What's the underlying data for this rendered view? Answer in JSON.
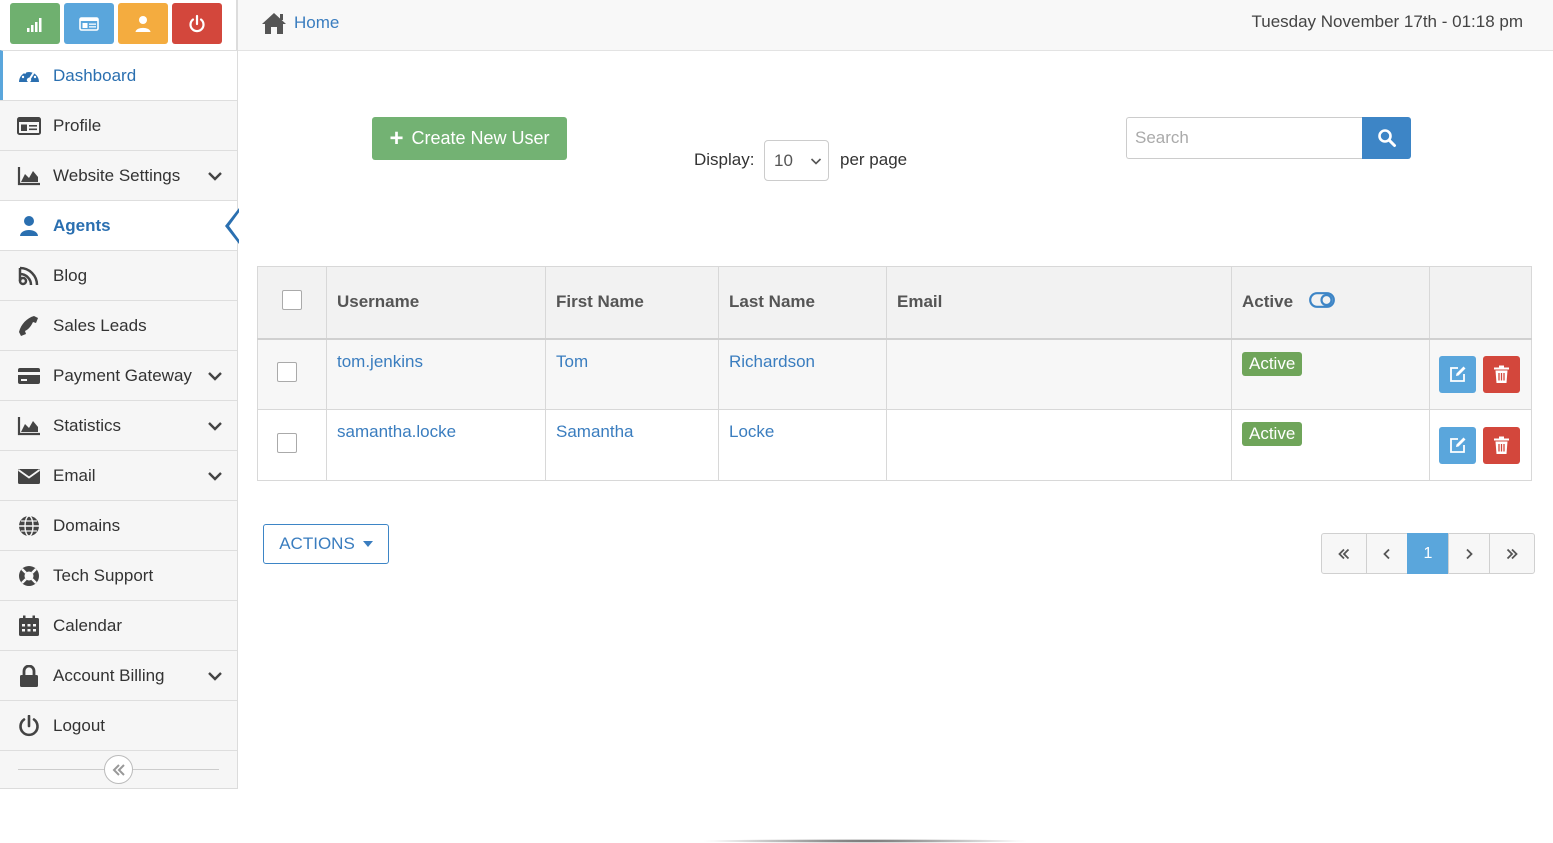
{
  "colors": {
    "shortcut_green": "#6fb06f",
    "shortcut_blue": "#5aa6dc",
    "shortcut_orange": "#f4ac3f",
    "shortcut_red": "#d3473c",
    "link_blue": "#3a7dbf",
    "create_green": "#73b273",
    "active_badge": "#6fa55a"
  },
  "shortcuts": [
    {
      "icon": "signal-bars-icon"
    },
    {
      "icon": "id-card-icon"
    },
    {
      "icon": "user-icon"
    },
    {
      "icon": "power-icon"
    }
  ],
  "sidebar": {
    "items": [
      {
        "label": "Dashboard",
        "icon": "dashboard-gauge-icon"
      },
      {
        "label": "Profile",
        "icon": "id-card-icon"
      },
      {
        "label": "Website Settings",
        "icon": "area-chart-icon",
        "has_submenu": true
      },
      {
        "label": "Agents",
        "icon": "user-icon",
        "active": true
      },
      {
        "label": "Blog",
        "icon": "rss-icon"
      },
      {
        "label": "Sales Leads",
        "icon": "phone-icon"
      },
      {
        "label": "Payment Gateway",
        "icon": "credit-card-icon",
        "has_submenu": true
      },
      {
        "label": "Statistics",
        "icon": "area-chart-icon",
        "has_submenu": true
      },
      {
        "label": "Email",
        "icon": "envelope-icon",
        "has_submenu": true
      },
      {
        "label": "Domains",
        "icon": "globe-icon"
      },
      {
        "label": "Tech Support",
        "icon": "life-ring-icon"
      },
      {
        "label": "Calendar",
        "icon": "calendar-icon"
      },
      {
        "label": "Account Billing",
        "icon": "lock-icon",
        "has_submenu": true
      },
      {
        "label": "Logout",
        "icon": "power-icon"
      }
    ],
    "collapse_icon": "double-chevron-left-icon"
  },
  "topbar": {
    "breadcrumb": "Home",
    "datetime": "Tuesday November 17th - 01:18 pm"
  },
  "toolbar": {
    "create_label": "Create New User",
    "display_label": "Display:",
    "per_page_value": "10",
    "per_page_label": "per page",
    "search_placeholder": "Search"
  },
  "table": {
    "headers": {
      "username": "Username",
      "first_name": "First Name",
      "last_name": "Last Name",
      "email": "Email",
      "active": "Active"
    },
    "rows": [
      {
        "username": "tom.jenkins",
        "first_name": "Tom",
        "last_name": "Richardson",
        "email": "",
        "status": "Active"
      },
      {
        "username": "samantha.locke",
        "first_name": "Samantha",
        "last_name": "Locke",
        "email": "",
        "status": "Active"
      }
    ]
  },
  "footer": {
    "actions_label": "ACTIONS",
    "current_page": "1"
  }
}
